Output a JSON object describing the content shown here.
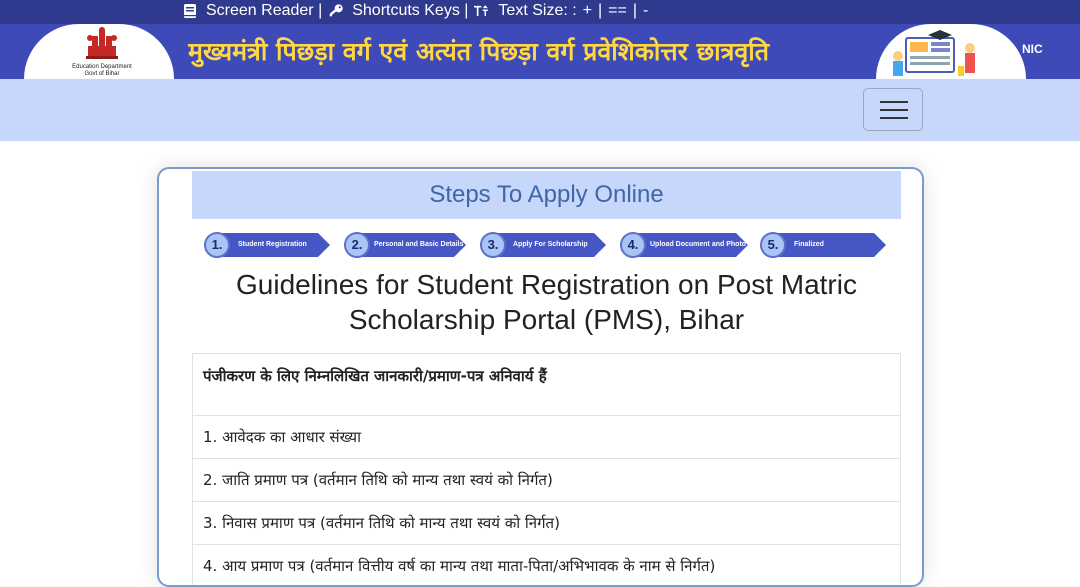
{
  "a11y_bar": {
    "screen_reader": "Screen Reader |",
    "shortcuts": "Shortcuts Keys |",
    "text_size": "Text Size: :",
    "increase": "+",
    "sep1": "|",
    "reset": "==",
    "sep2": "|",
    "decrease": "-"
  },
  "banner": {
    "title": "मुख्यमंत्री पिछड़ा वर्ग एवं अत्यंत पिछड़ा वर्ग प्रवेशिकोत्तर छात्रवृति",
    "logo_caption_1": "Education Department",
    "logo_caption_2": "Govt of Bihar",
    "nic": "NIC"
  },
  "card": {
    "heading": "Steps To Apply Online",
    "steps": [
      {
        "num": "1.",
        "label": "Student Registration"
      },
      {
        "num": "2.",
        "label": "Personal and Basic Details"
      },
      {
        "num": "3.",
        "label": "Apply For Scholarship"
      },
      {
        "num": "4.",
        "label": "Upload Document and Photo"
      },
      {
        "num": "5.",
        "label": "Finalized"
      }
    ],
    "guide_title": "Guidelines for Student Registration on Post Matric Scholarship Portal (PMS), Bihar",
    "requirements": {
      "header": "पंजीकरण के लिए निम्नलिखित जानकारी/प्रमाण-पत्र अनिवार्य हैं",
      "items": [
        "1. आवेदक का आधार संख्या",
        "2. जाति प्रमाण पत्र (वर्तमान तिथि को मान्य तथा स्वयं को निर्गत)",
        "3. निवास प्रमाण पत्र (वर्तमान तिथि को मान्य तथा स्वयं को निर्गत)",
        "4. आय प्रमाण पत्र (वर्तमान वित्तीय वर्ष का मान्य तथा माता-पिता/अभिभावक के नाम से निर्गत)"
      ]
    }
  },
  "colors": {
    "top_bar": "#2f3a8f",
    "banner": "#3e4ab8",
    "banner_title": "#ffd740",
    "navbar": "#c7d7fb",
    "step_arrow": "#4656c4",
    "card_border": "#7b9acd"
  }
}
